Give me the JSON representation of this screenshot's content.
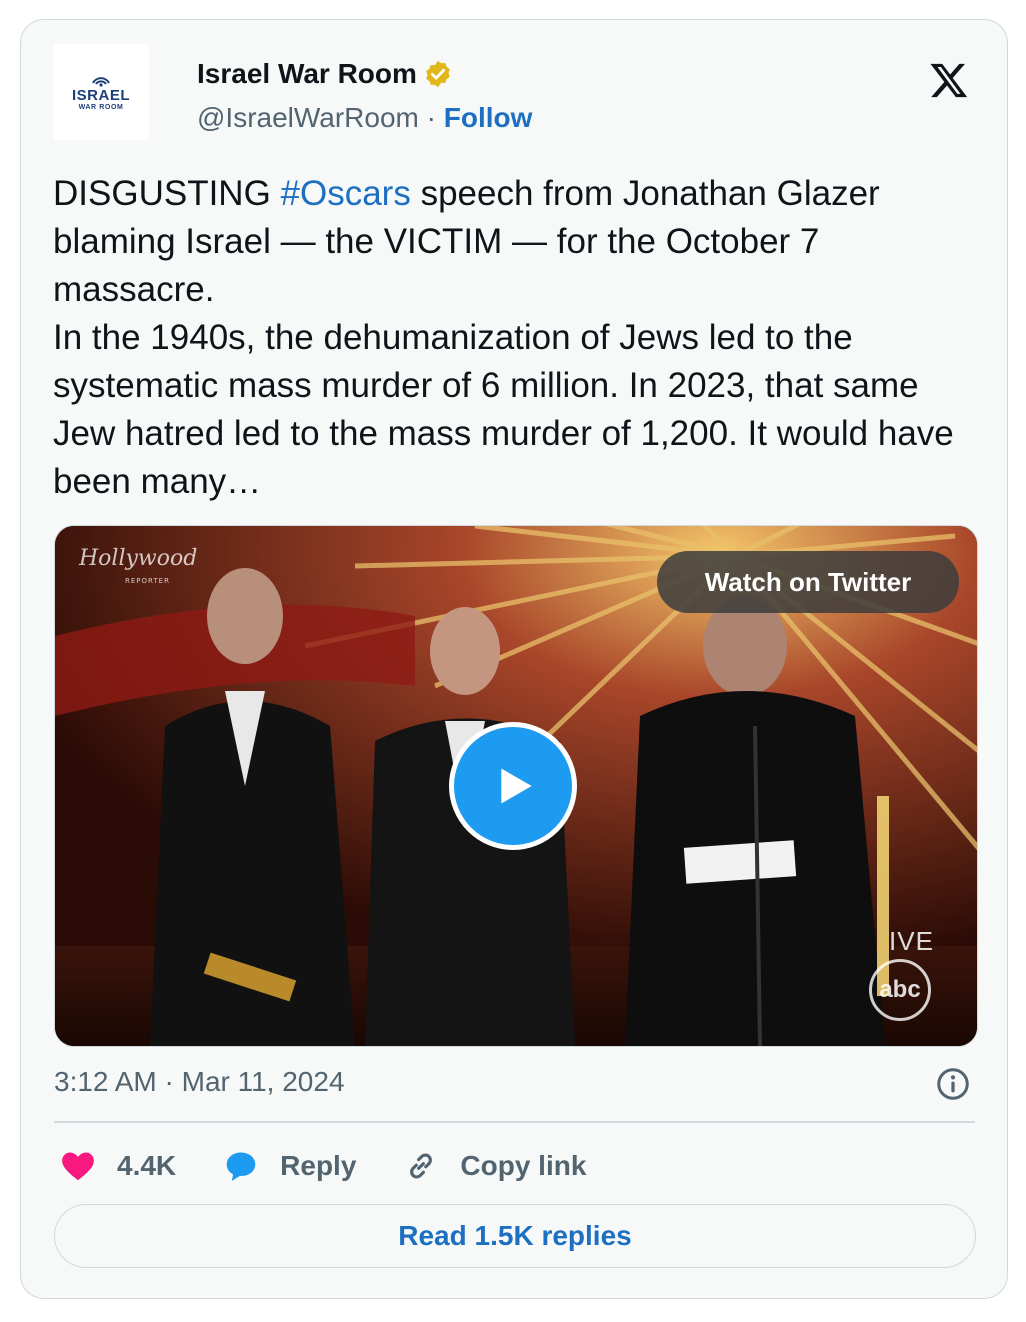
{
  "author": {
    "name": "Israel War Room",
    "handle": "@IsraelWarRoom",
    "separator": "·",
    "follow_label": "Follow",
    "avatar_text_top": "ISRAEL",
    "avatar_text_bottom": "WAR ROOM"
  },
  "tweet": {
    "text_before_hashtag": "DISGUSTING ",
    "hashtag": "#Oscars",
    "text_after_hashtag": " speech from Jonathan Glazer blaming Israel — the VICTIM — for the October 7 massacre.\nIn the 1940s, the dehumanization of Jews led to the systematic mass murder of 6 million. In 2023, that same Jew hatred led to the mass murder of 1,200. It would have been many…"
  },
  "media": {
    "watch_label": "Watch on Twitter",
    "watermark": "Hollywood",
    "watermark_sub": "REPORTER",
    "live_label": "IVE",
    "network_logo": "abc"
  },
  "meta": {
    "timestamp": "3:12 AM · Mar 11, 2024"
  },
  "actions": {
    "likes": "4.4K",
    "reply_label": "Reply",
    "copy_label": "Copy link"
  },
  "read_replies_label": "Read 1.5K replies",
  "colors": {
    "accent": "#1d6fc1",
    "play": "#1d9bf0",
    "like": "#f91880",
    "muted": "#536471"
  },
  "icons": [
    "verified-badge-icon",
    "x-logo-icon",
    "play-icon",
    "info-icon",
    "heart-icon",
    "reply-bubble-icon",
    "link-icon"
  ]
}
